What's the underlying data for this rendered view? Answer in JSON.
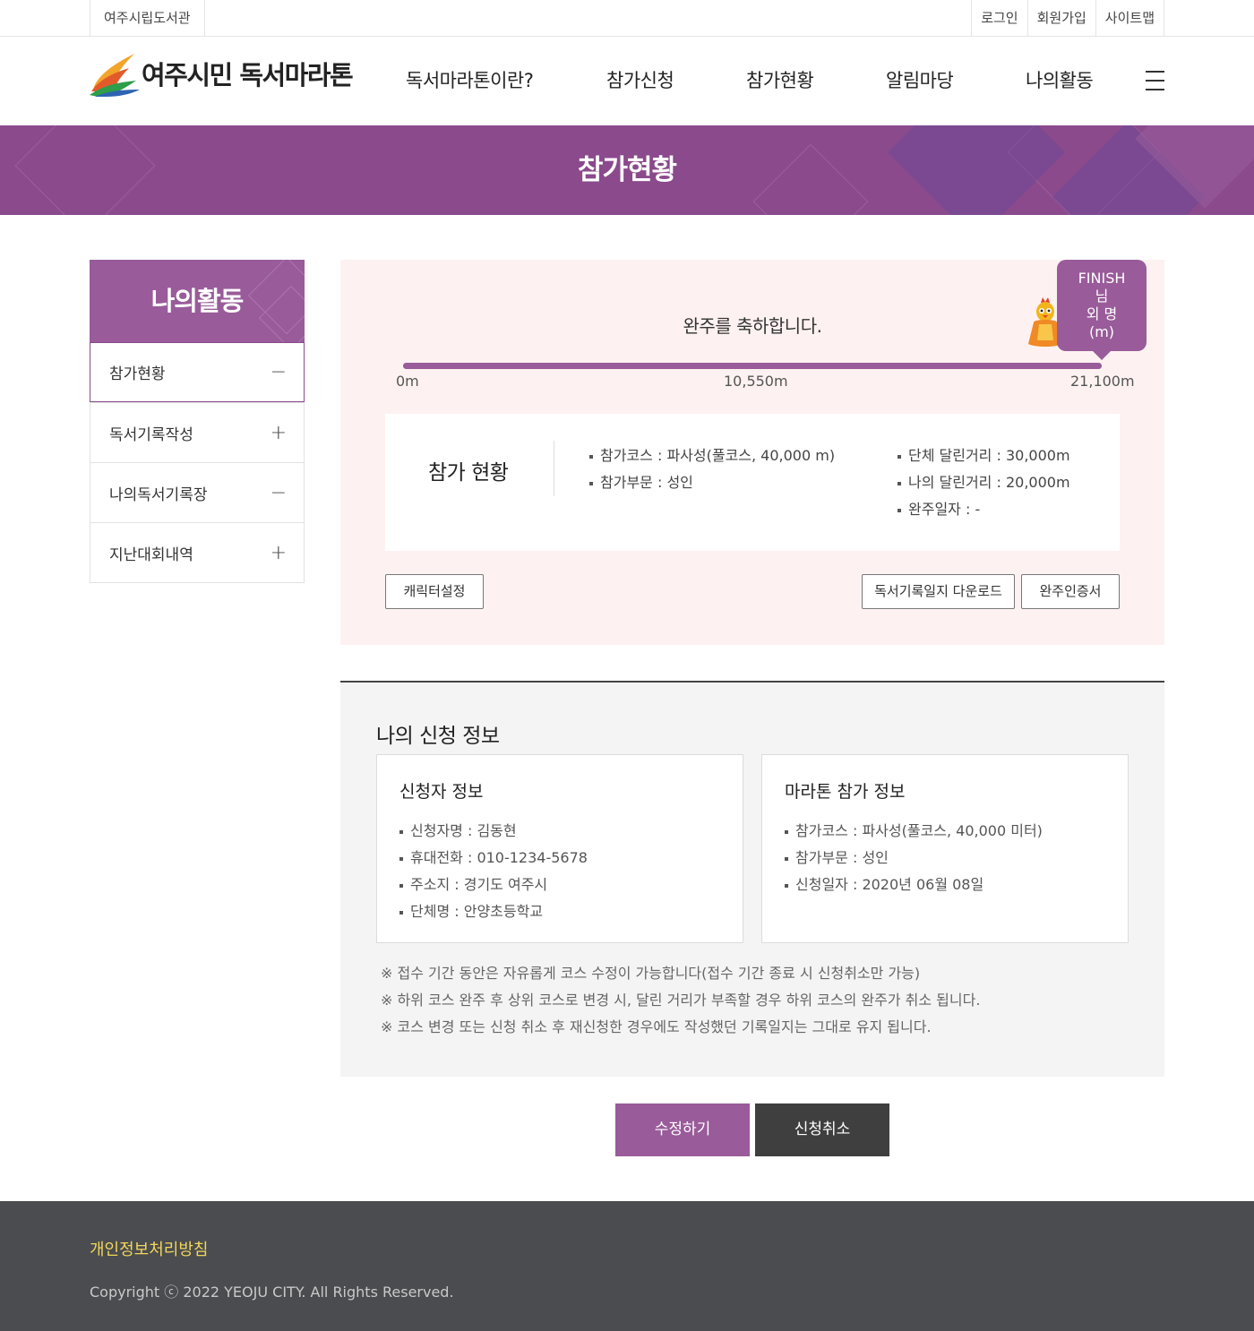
{
  "topbar": {
    "library": "여주시립도서관",
    "links": [
      "로그인",
      "회원가입",
      "사이트맵"
    ]
  },
  "header": {
    "logo_text": "여주시민 독서마라톤",
    "nav": [
      "독서마라톤이란?",
      "참가신청",
      "참가현황",
      "알림마당",
      "나의활동"
    ]
  },
  "banner": {
    "title": "참가현황"
  },
  "sidebar": {
    "title": "나의활동",
    "items": [
      {
        "label": "참가현황",
        "sign": "−"
      },
      {
        "label": "독서기록작성",
        "sign": "+"
      },
      {
        "label": "나의독서기록장",
        "sign": "−"
      },
      {
        "label": "지난대회내역",
        "sign": "+"
      }
    ]
  },
  "progress": {
    "message": "완주를 축하합니다.",
    "fraction": 1.0,
    "marks": [
      "0m",
      "10,550m",
      "21,100m"
    ],
    "bubble": [
      "FINISH",
      "님",
      "외 명",
      "(m)"
    ]
  },
  "status": {
    "label": "참가 현황",
    "left": [
      "참가코스 : 파사성(풀코스, 40,000 m)",
      "참가부문 : 성인"
    ],
    "right": [
      "단체 달린거리 : 30,000m",
      "나의 달린거리 : 20,000m",
      "완주일자 : -"
    ]
  },
  "buttons": {
    "character": "캐릭터설정",
    "download": "독서기록일지 다운로드",
    "certificate": "완주인증서",
    "edit": "수정하기",
    "cancel": "신청취소"
  },
  "apply": {
    "title": "나의 신청 정보",
    "applicant": {
      "title": "신청자 정보",
      "items": [
        "신청자명 : 김동현",
        "휴대전화 : 010-1234-5678",
        "주소지 : 경기도 여주시",
        "단체명 : 안양초등학교"
      ]
    },
    "marathon": {
      "title": "마라톤 참가 정보",
      "items": [
        "참가코스 : 파사성(풀코스, 40,000 미터)",
        "참가부문 : 성인",
        "신청일자 : 2020년 06월 08일"
      ]
    },
    "notes": [
      "※ 접수 기간 동안은 자유롭게 코스 수정이 가능합니다(접수 기간 종료 시 신청취소만 가능)",
      "※ 하위 코스 완주 후 상위 코스로 변경 시, 달린 거리가 부족할 경우 하위 코스의 완주가 취소 됩니다.",
      "※ 코스 변경 또는 신청 취소 후 재신청한 경우에도 작성했던 기록일지는 그대로 유지 됩니다."
    ]
  },
  "footer": {
    "privacy": "개인정보처리방침",
    "copyright": "Copyright ⓒ 2022 YEOJU CITY. All Rights Reserved."
  },
  "colors": {
    "accent": "#995b9a",
    "banner": "#8a4a8c",
    "dark_button": "#3f3f3f",
    "footer": "#4a4c4f"
  }
}
